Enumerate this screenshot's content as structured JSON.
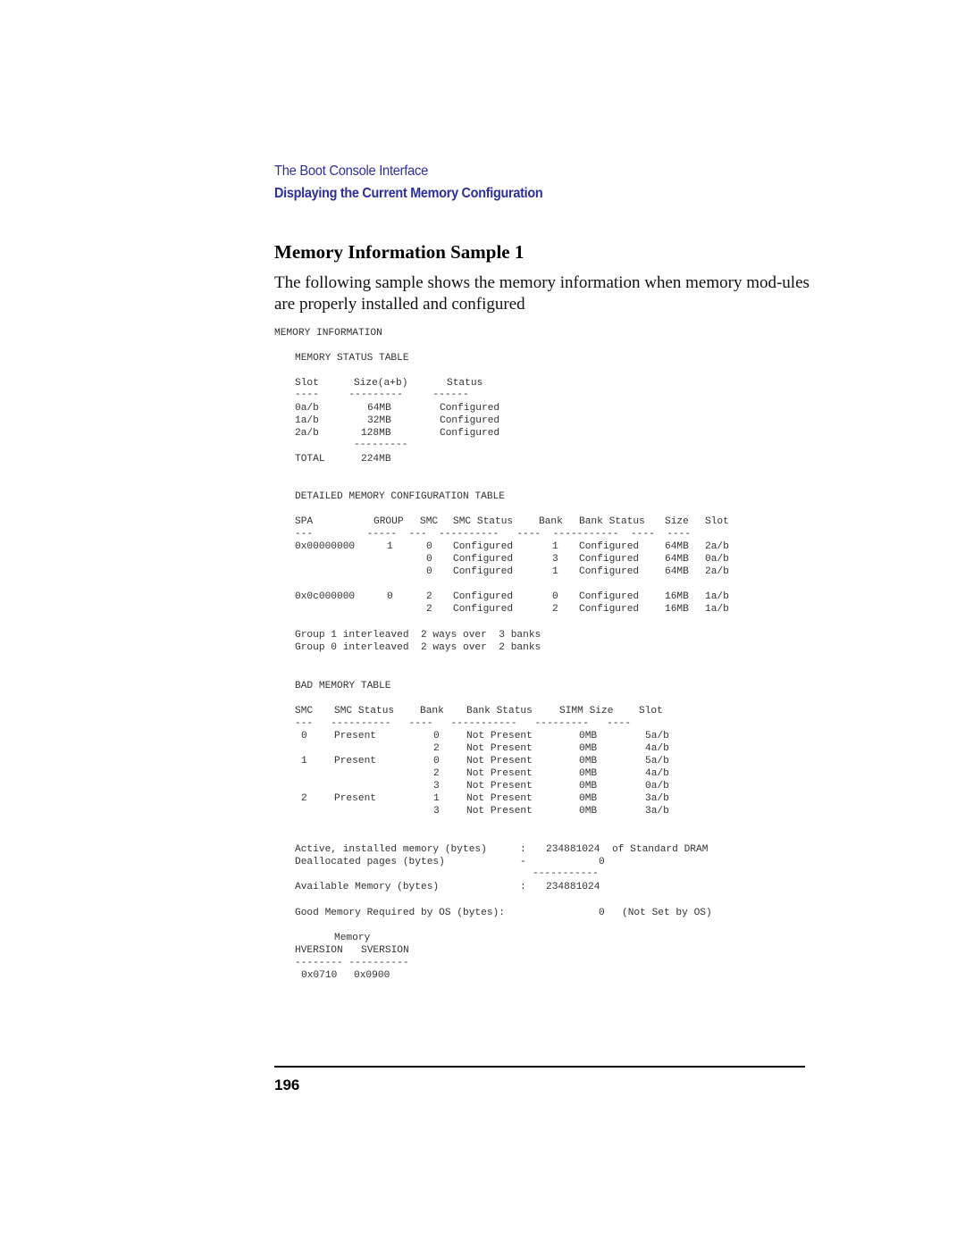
{
  "header": {
    "chapter": "The Boot Console Interface",
    "section": "Displaying the Current Memory Configuration"
  },
  "title": "Memory Information Sample 1",
  "intro": "The following sample shows the memory information when memory mod-ules are properly installed and configured",
  "screen": {
    "heading": "MEMORY INFORMATION",
    "status_table": {
      "title": "MEMORY STATUS TABLE",
      "columns": [
        "Slot",
        "Size(a+b)",
        "Status"
      ],
      "rows": [
        [
          "0a/b",
          "64MB",
          "Configured"
        ],
        [
          "1a/b",
          "32MB",
          "Configured"
        ],
        [
          "2a/b",
          "128MB",
          "Configured"
        ]
      ],
      "total_label": "TOTAL",
      "total_value": "224MB"
    },
    "config_table": {
      "title": "DETAILED MEMORY CONFIGURATION TABLE",
      "columns": [
        "SPA",
        "GROUP",
        "SMC",
        "SMC Status",
        "Bank",
        "Bank Status",
        "Size",
        "Slot"
      ],
      "rows": [
        [
          "0x00000000",
          "1",
          "0",
          "Configured",
          "1",
          "Configured",
          "64MB",
          "2a/b"
        ],
        [
          "",
          "",
          "0",
          "Configured",
          "3",
          "Configured",
          "64MB",
          "0a/b"
        ],
        [
          "",
          "",
          "0",
          "Configured",
          "1",
          "Configured",
          "64MB",
          "2a/b"
        ],
        [
          "0x0c000000",
          "0",
          "2",
          "Configured",
          "0",
          "Configured",
          "16MB",
          "1a/b"
        ],
        [
          "",
          "",
          "2",
          "Configured",
          "2",
          "Configured",
          "16MB",
          "1a/b"
        ]
      ],
      "interleave": [
        "Group 1 interleaved  2 ways over  3 banks",
        "Group 0 interleaved  2 ways over  2 banks"
      ]
    },
    "bad_table": {
      "title": "BAD MEMORY TABLE",
      "columns": [
        "SMC",
        "SMC Status",
        "Bank",
        "Bank Status",
        "SIMM Size",
        "Slot"
      ],
      "rows": [
        [
          "0",
          "Present",
          "0",
          "Not Present",
          "0MB",
          "5a/b"
        ],
        [
          "",
          "",
          "2",
          "Not Present",
          "0MB",
          "4a/b"
        ],
        [
          "1",
          "Present",
          "0",
          "Not Present",
          "0MB",
          "5a/b"
        ],
        [
          "",
          "",
          "2",
          "Not Present",
          "0MB",
          "4a/b"
        ],
        [
          "",
          "",
          "3",
          "Not Present",
          "0MB",
          "0a/b"
        ],
        [
          "2",
          "Present",
          "1",
          "Not Present",
          "0MB",
          "3a/b"
        ],
        [
          "",
          "",
          "3",
          "Not Present",
          "0MB",
          "3a/b"
        ]
      ]
    },
    "summary": {
      "active_label": "Active, installed memory (bytes)",
      "active_sep": ":",
      "active_value": "234881024",
      "active_suffix": "of Standard DRAM",
      "dealloc_label": "Deallocated pages (bytes)",
      "dealloc_sep": "-",
      "dealloc_value": "0",
      "available_label": "Available Memory (bytes)",
      "available_sep": ":",
      "available_value": "234881024",
      "good_label": "Good Memory Required by OS (bytes):",
      "good_value": "0",
      "good_suffix": "(Not Set by OS)"
    },
    "versions": {
      "caption": "Memory",
      "hversion_label": "HVERSION",
      "sversion_label": "SVERSION",
      "hversion_value": "0x0710",
      "sversion_value": "0x0900"
    }
  },
  "page_number": "196"
}
